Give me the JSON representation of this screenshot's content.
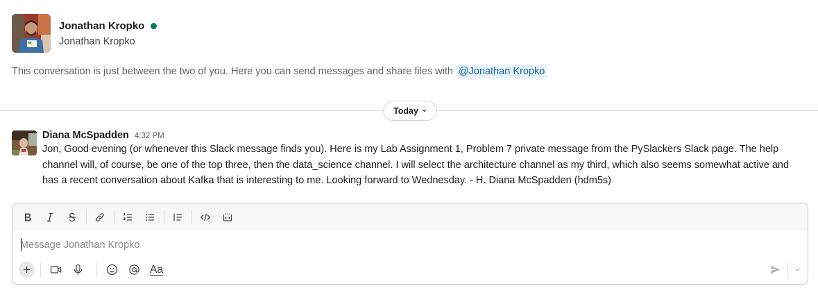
{
  "profile": {
    "name": "Jonathan Kropko",
    "display_name": "Jonathan Kropko",
    "status": "online",
    "presence_color": "#007a5a"
  },
  "intro": {
    "text": "This conversation is just between the two of you. Here you can send messages and share files with",
    "mention": "@Jonathan Kropko"
  },
  "divider": {
    "label": "Today"
  },
  "messages": [
    {
      "author": "Diana McSpadden",
      "time": "4:32 PM",
      "text": "Jon, Good evening (or whenever this Slack message finds you). Here is my Lab Assignment 1, Problem 7 private message from the PySlackers Slack page. The help channel will, of course, be one of the top three, then the data_science channel. I will select the architecture channel as my third, which also seems somewhat active and has a recent conversation about Kafka that is interesting to me. Looking forward to Wednesday. - H. Diana McSpadden (hdm5s)"
    }
  ],
  "composer": {
    "placeholder": "Message Jonathan Kropko",
    "value": "",
    "format_buttons": [
      "bold-icon",
      "italic-icon",
      "strikethrough-icon",
      "link-icon",
      "ordered-list-icon",
      "bulleted-list-icon",
      "blockquote-icon",
      "code-icon",
      "code-block-icon"
    ],
    "text_format_label": "Aa",
    "accent_color": "#1264a3"
  }
}
